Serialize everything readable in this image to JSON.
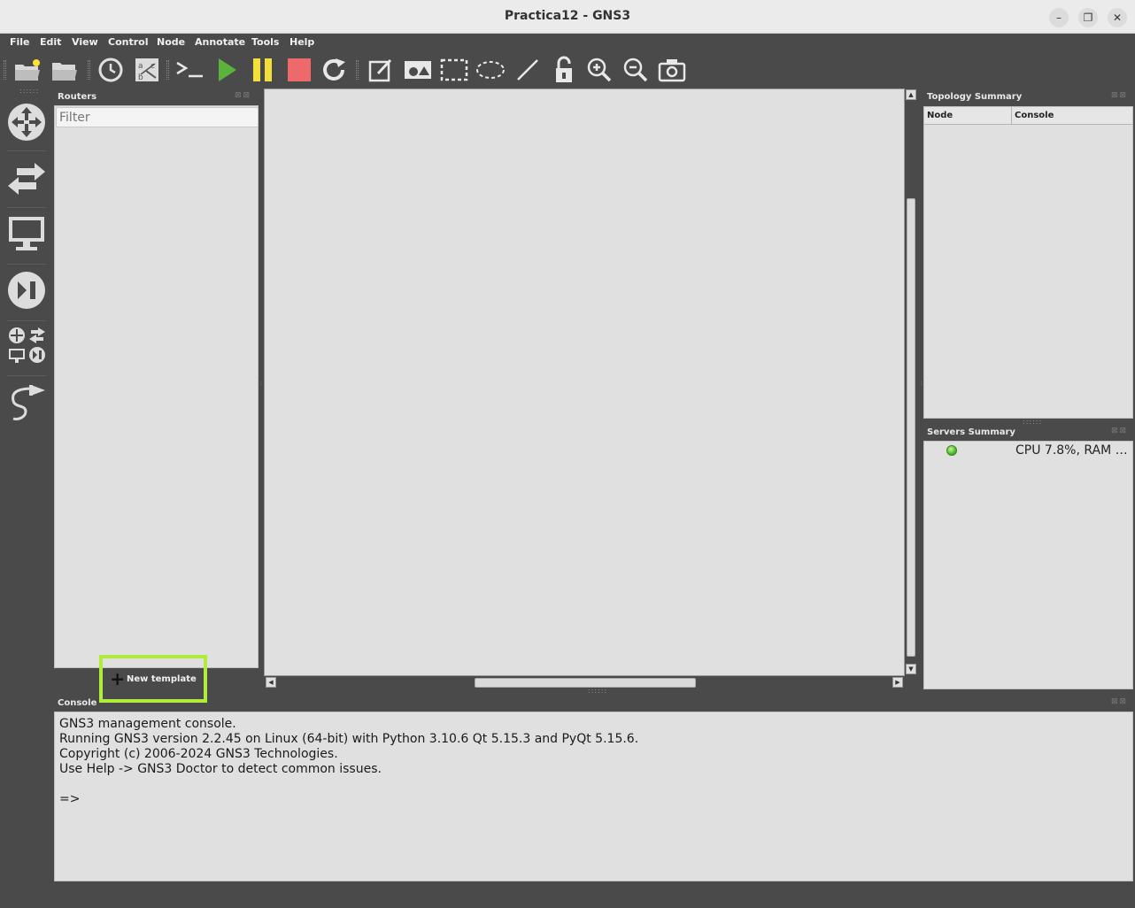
{
  "window": {
    "title": "Practica12 - GNS3"
  },
  "menu": [
    {
      "label": "File"
    },
    {
      "label": "Edit"
    },
    {
      "label": "View"
    },
    {
      "label": "Control"
    },
    {
      "label": "Node"
    },
    {
      "label": "Annotate"
    },
    {
      "label": "Tools"
    },
    {
      "label": "Help"
    }
  ],
  "toolbar": {
    "items": [
      "new-project-icon",
      "open-project-icon",
      "snapshot-clock-icon",
      "show-interface-labels-icon",
      "console-all-icon",
      "start-all-icon",
      "suspend-all-icon",
      "stop-all-icon",
      "reload-all-icon",
      "add-note-icon",
      "insert-image-icon",
      "draw-rectangle-icon",
      "draw-ellipse-icon",
      "draw-line-icon",
      "lock-unlock-icon",
      "zoom-in-icon",
      "zoom-out-icon",
      "screenshot-icon"
    ],
    "colors": {
      "start": "#5cb33c",
      "suspend": "#f2df3a",
      "stop": "#ee6a6a"
    }
  },
  "nodebar": {
    "items": [
      "routers-icon",
      "switches-icon",
      "end-devices-icon",
      "security-devices-icon",
      "all-devices-icon",
      "add-link-icon"
    ]
  },
  "routers_panel": {
    "title": "Routers",
    "filter_placeholder": "Filter",
    "new_template_label": "New template"
  },
  "topology_summary": {
    "title": "Topology Summary",
    "columns": [
      "Node",
      "Console"
    ]
  },
  "servers_summary": {
    "title": "Servers Summary",
    "status_text": "CPU 7.8%, RAM …"
  },
  "console": {
    "title": "Console",
    "lines": [
      "GNS3 management console.",
      "Running GNS3 version 2.2.45 on Linux (64-bit) with Python 3.10.6 Qt 5.15.3 and PyQt 5.15.6.",
      "Copyright (c) 2006-2024 GNS3 Technologies.",
      "Use Help -> GNS3 Doctor to detect common issues.",
      "",
      "=>"
    ]
  },
  "highlight_color": "#b0ec3a"
}
